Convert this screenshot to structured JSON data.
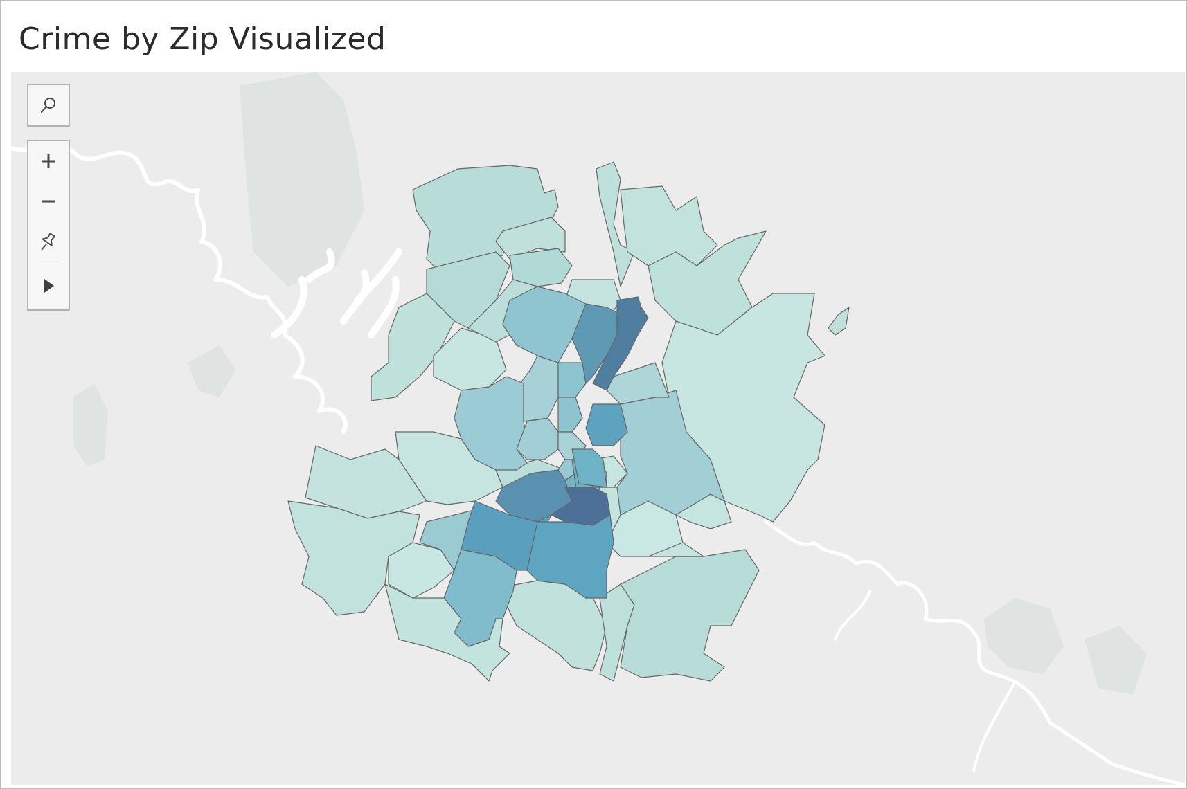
{
  "title": "Crime by Zip Visualized",
  "map_controls": {
    "search": {
      "icon": "search-icon"
    },
    "zoom_in": {
      "icon": "plus-icon"
    },
    "zoom_out": {
      "icon": "minus-icon"
    },
    "pin": {
      "icon": "pin-icon"
    },
    "expand": {
      "icon": "play-icon"
    }
  },
  "colors": {
    "background": "#ececec",
    "water": "#ffffff",
    "region_border": "#666666",
    "scale_low": "#c6e4df",
    "scale_high": "#4b6b91"
  }
}
